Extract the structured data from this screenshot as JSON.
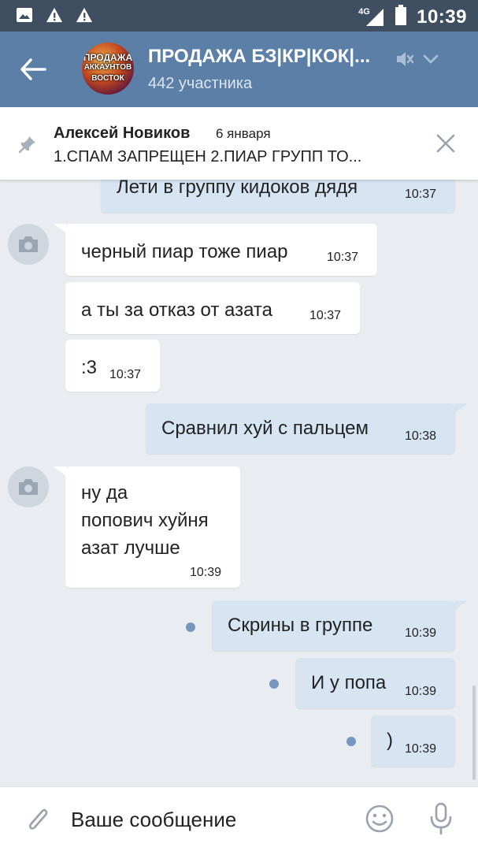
{
  "status_bar": {
    "network": "4G",
    "time": "10:39",
    "icons": [
      "image-icon",
      "warning-icon",
      "warning-icon",
      "signal-icon",
      "battery-icon"
    ]
  },
  "header": {
    "title": "ПРОДАЖА БЗ|КР|КОК|...",
    "subtitle": "442 участника",
    "avatar_text": [
      "ПРОДАЖА",
      "АККАУНТОВ",
      "ВОСТОК"
    ],
    "bg_color": "#5b7fa6"
  },
  "pinned": {
    "author": "Алексей Новиков",
    "date": "6 января",
    "text": "1.СПАМ ЗАПРЕЩЕН  2.ПИАР ГРУПП ТО..."
  },
  "messages": [
    {
      "dir": "out",
      "text": "Лети в группу кидоков дядя",
      "time": "10:37"
    },
    {
      "dir": "in",
      "text": "черный пиар тоже пиар",
      "time": "10:37"
    },
    {
      "dir": "in",
      "text": "а ты за отказ от азата",
      "time": "10:37"
    },
    {
      "dir": "in",
      "text": ":3",
      "time": "10:37"
    },
    {
      "dir": "out",
      "text": "Сравнил хуй с пальцем",
      "time": "10:38"
    },
    {
      "dir": "in",
      "lines": [
        "ну да",
        "попович хуйня",
        "азат лучше"
      ],
      "time": "10:39"
    },
    {
      "dir": "out",
      "text": "Скрины в группе",
      "time": "10:39",
      "unread": true
    },
    {
      "dir": "out",
      "text": "И у попа",
      "time": "10:39",
      "unread": true
    },
    {
      "dir": "out",
      "text": ")",
      "time": "10:39",
      "unread": true
    }
  ],
  "input": {
    "placeholder": "Ваше сообщение"
  },
  "colors": {
    "outgoing_bubble": "#d7e5f3",
    "incoming_bubble": "#ffffff",
    "chat_background": "#e9edf1",
    "unread_dot": "#7597c0"
  }
}
